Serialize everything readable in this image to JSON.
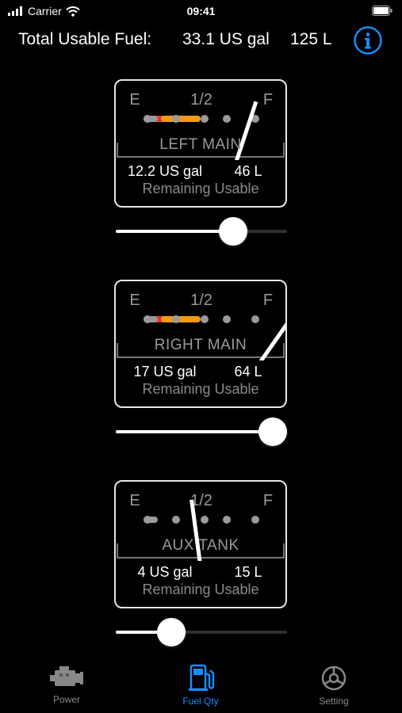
{
  "status_bar": {
    "carrier": "Carrier",
    "time": "09:41"
  },
  "header": {
    "label": "Total Usable Fuel:",
    "gallons": "33.1 US gal",
    "liters": "125 L"
  },
  "scale": {
    "empty": "E",
    "half": "1/2",
    "full": "F"
  },
  "footer_label": "Remaining Usable",
  "tanks": [
    {
      "name": "LEFT MAIN",
      "gallons": "12.2 US gal",
      "liters": "46 L",
      "level": 0.72
    },
    {
      "name": "RIGHT MAIN",
      "gallons": "17 US gal",
      "liters": "64 L",
      "level": 1.0
    },
    {
      "name": "AUX TANK",
      "gallons": "4 US gal",
      "liters": "15 L",
      "level": 0.29
    }
  ],
  "tabs": [
    {
      "label": "Power",
      "icon": "engine-icon",
      "active": false
    },
    {
      "label": "Fuel Qty",
      "icon": "fuel-pump-icon",
      "active": true
    },
    {
      "label": "Setting",
      "icon": "gear-icon",
      "active": false
    }
  ],
  "colors": {
    "accent": "#1a8cff",
    "red": "#e0342c",
    "orange": "#f09a1a",
    "dot": "#9a9a9a"
  }
}
